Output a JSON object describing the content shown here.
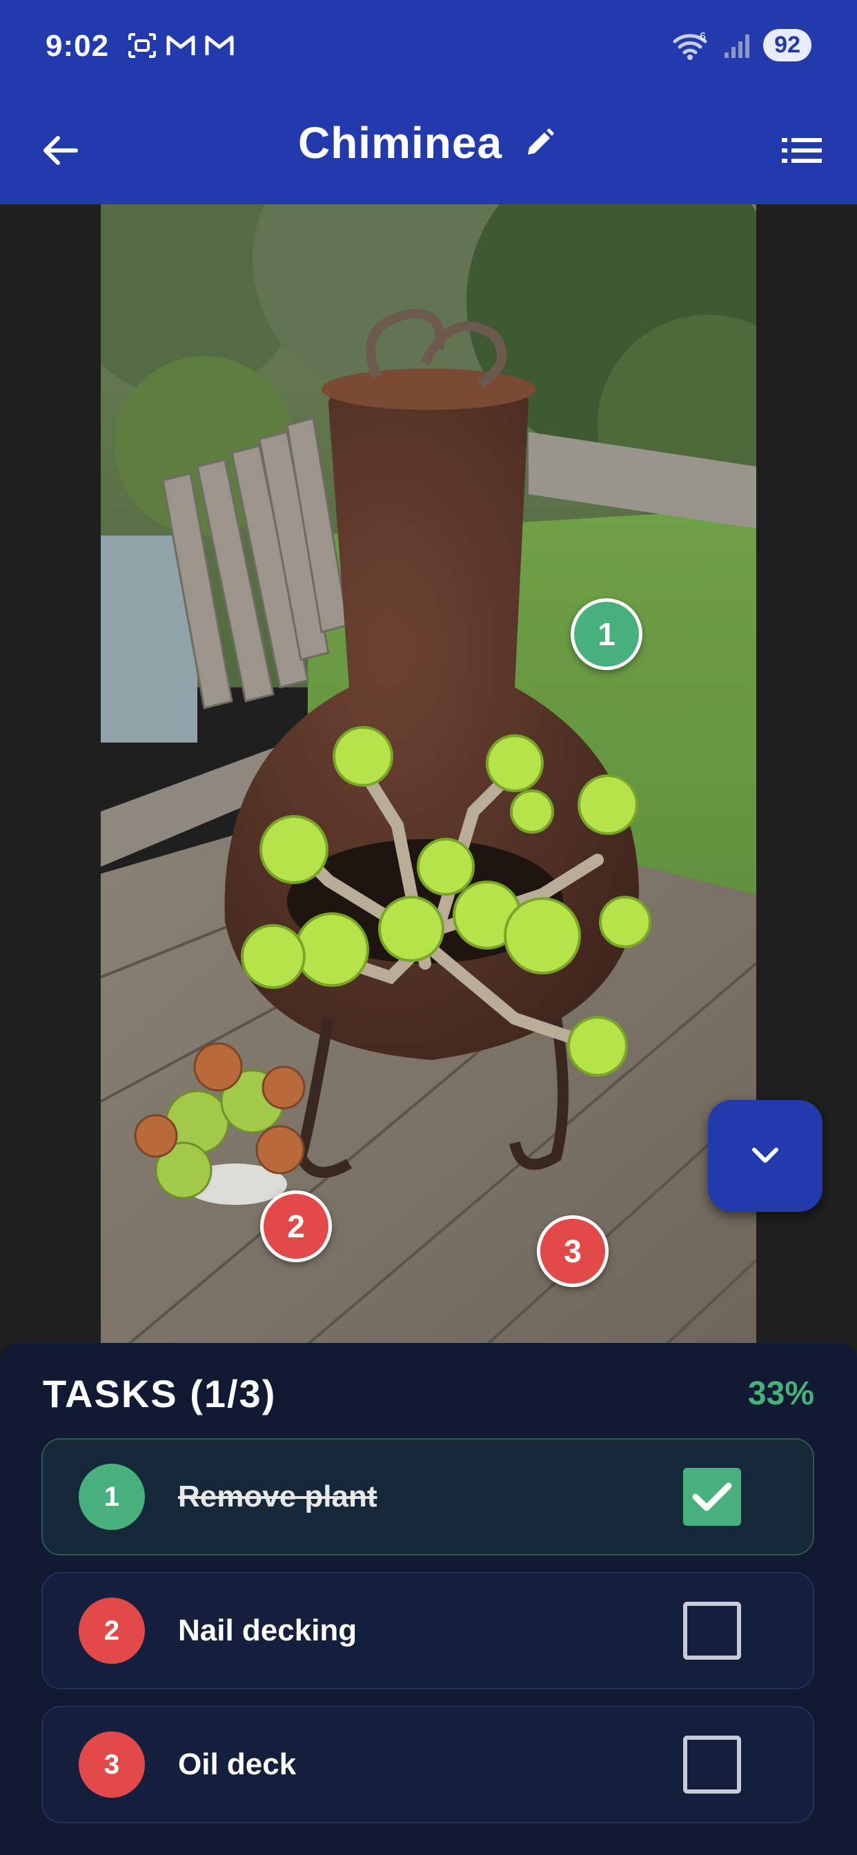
{
  "status_bar": {
    "time": "9:02",
    "network": "6",
    "battery": "92"
  },
  "app_bar": {
    "title": "Chiminea",
    "icons": [
      "arrow-left-icon",
      "pencil-icon",
      "list-icon"
    ]
  },
  "photo": {
    "subject": "chiminea-with-succulents",
    "markers": [
      {
        "number": "1",
        "color": "#48b07d",
        "status": "done"
      },
      {
        "number": "2",
        "color": "#e24a4a",
        "status": "open"
      },
      {
        "number": "3",
        "color": "#e24a4a",
        "status": "open"
      }
    ]
  },
  "fab": {
    "icon": "chevron-down-icon"
  },
  "tasks": {
    "title": "TASKS (1/3)",
    "progress": "33%",
    "items": [
      {
        "number": "1",
        "label": "Remove plant",
        "done": true
      },
      {
        "number": "2",
        "label": "Nail decking",
        "done": false
      },
      {
        "number": "3",
        "label": "Oil deck",
        "done": false
      }
    ]
  },
  "colors": {
    "primary": "#233aad",
    "done": "#48b07d",
    "pending": "#e24a4a",
    "panel": "#121a33"
  }
}
